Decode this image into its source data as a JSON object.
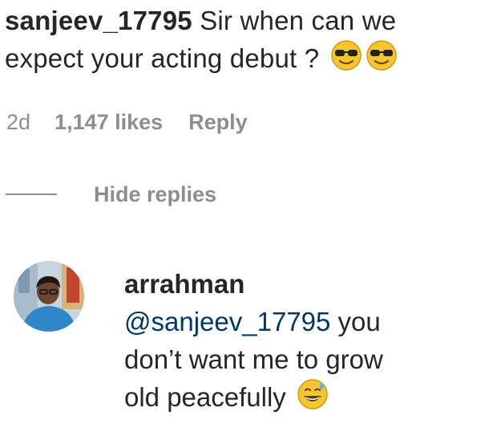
{
  "comment": {
    "username": "sanjeev_17795",
    "text_line1": "Sir when can we",
    "text_line2": "expect your acting debut ?",
    "emojis": [
      "sunglasses-emoji",
      "sunglasses-emoji"
    ]
  },
  "meta": {
    "time": "2d",
    "likes": "1,147 likes",
    "reply": "Reply"
  },
  "replies_toggle": {
    "label": "Hide replies"
  },
  "reply": {
    "username": "arrahman",
    "mention": "@sanjeev_17795",
    "text_part1": " you",
    "text_line2": "don’t want me to grow",
    "text_line3": "old peacefully",
    "emoji": "grinning-sweat-emoji"
  },
  "colors": {
    "text": "#262626",
    "secondary": "#8e8e8e",
    "link": "#00376b",
    "emoji_yellow": "#f7c531"
  }
}
